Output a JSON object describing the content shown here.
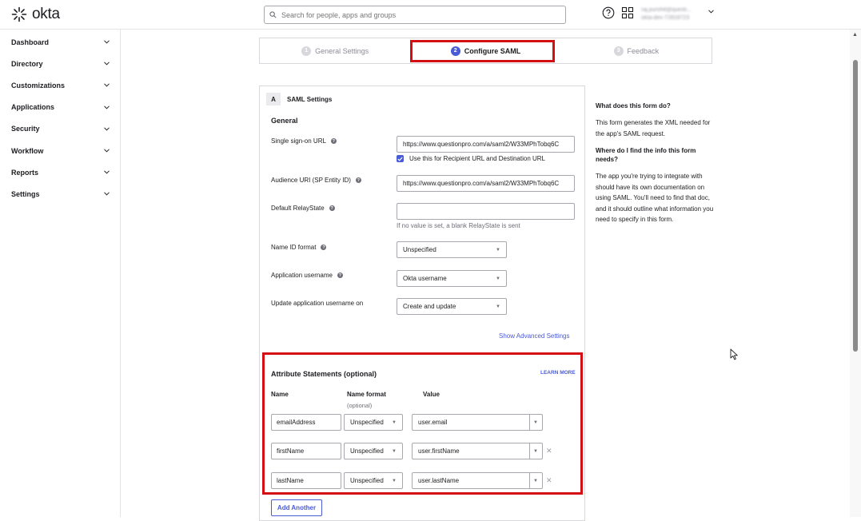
{
  "header": {
    "logo_text": "okta",
    "search_placeholder": "Search for people, apps and groups",
    "user_name": "raj.purohit@questi...",
    "user_org": "okta-dev-72818723"
  },
  "sidebar": {
    "items": [
      {
        "label": "Dashboard"
      },
      {
        "label": "Directory"
      },
      {
        "label": "Customizations"
      },
      {
        "label": "Applications"
      },
      {
        "label": "Security"
      },
      {
        "label": "Workflow"
      },
      {
        "label": "Reports"
      },
      {
        "label": "Settings"
      }
    ]
  },
  "steps": [
    {
      "num": "1",
      "label": "General Settings"
    },
    {
      "num": "2",
      "label": "Configure SAML"
    },
    {
      "num": "3",
      "label": "Feedback"
    }
  ],
  "form": {
    "letter": "A",
    "title": "SAML Settings",
    "section": "General",
    "sso_label": "Single sign-on URL",
    "sso_value": "https://www.questionpro.com/a/saml2/W33MPhTobq6C",
    "sso_checkbox": "Use this for Recipient URL and Destination URL",
    "audience_label": "Audience URI (SP Entity ID)",
    "audience_value": "https://www.questionpro.com/a/saml2/W33MPhTobq6C",
    "relay_label": "Default RelayState",
    "relay_value": "",
    "relay_hint": "If no value is set, a blank RelayState is sent",
    "nameid_label": "Name ID format",
    "nameid_value": "Unspecified",
    "appuser_label": "Application username",
    "appuser_value": "Okta username",
    "update_label": "Update application username on",
    "update_value": "Create and update",
    "advanced_link": "Show Advanced Settings"
  },
  "attributes": {
    "title": "Attribute Statements (optional)",
    "learn_more": "LEARN MORE",
    "col_name": "Name",
    "col_format": "Name format",
    "col_format_sub": "(optional)",
    "col_value": "Value",
    "rows": [
      {
        "name": "emailAddress",
        "format": "Unspecified",
        "value": "user.email"
      },
      {
        "name": "firstName",
        "format": "Unspecified",
        "value": "user.firstName"
      },
      {
        "name": "lastName",
        "format": "Unspecified",
        "value": "user.lastName"
      }
    ],
    "add_button": "Add Another"
  },
  "help": {
    "q1": "What does this form do?",
    "a1": "This form generates the XML needed for the app's SAML request.",
    "q2": "Where do I find the info this form needs?",
    "a2": "The app you're trying to integrate with should have its own documentation on using SAML. You'll need to find that doc, and it should outline what information you need to specify in this form."
  },
  "colors": {
    "accent": "#4a5bd6",
    "highlight": "#d40f14"
  }
}
